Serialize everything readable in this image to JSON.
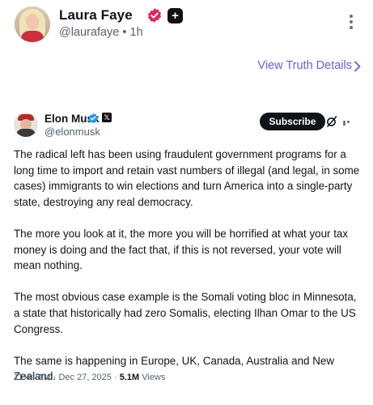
{
  "post": {
    "author_name": "Laura Faye",
    "author_handle": "@laurafaye",
    "separator": "•",
    "time": "1h",
    "plus_badge": "+",
    "truth_link_label": "View Truth Details"
  },
  "embed": {
    "name": "Elon Musk",
    "handle": "@elonmusk",
    "subscribe_label": "Subscribe",
    "paragraphs": [
      "The radical left has been using fraudulent government programs for a long time to import and retain vast numbers of illegal (and legal, in some cases) immigrants to win elections and turn America into a single-party state, destroying any real democracy.",
      "The more you look at it, the more you will be horrified at what your tax money is doing and the fact that, if this is not reversed, your vote will mean nothing.",
      "The most obvious case example is the Somali voting bloc in Minnesota, a state that historically had zero Somalis, electing Ilhan Omar to the US Congress.",
      "The same is happening in Europe, UK, Canada, Australia and New Zealand."
    ],
    "meta": {
      "time": "11:44 AM",
      "dot": "·",
      "date": "Dec 27, 2025",
      "views_count": "5.1M",
      "views_label": "Views"
    }
  },
  "colors": {
    "link_purple": "#6b5bd6",
    "verified_pink": "#e0245e",
    "verified_blue": "#1d9bf0",
    "text_primary": "#0f1419",
    "text_secondary": "#536471"
  },
  "icons": {
    "verified_pink": "verified-badge-icon",
    "plus": "plus-badge-icon",
    "kebab": "more-vertical-icon",
    "chevron": "chevron-right-icon",
    "elon_verified": "verified-badge-icon",
    "x_logo": "x-logo-icon",
    "grok": "grok-icon",
    "more_horizontal": "more-horizontal-icon"
  }
}
